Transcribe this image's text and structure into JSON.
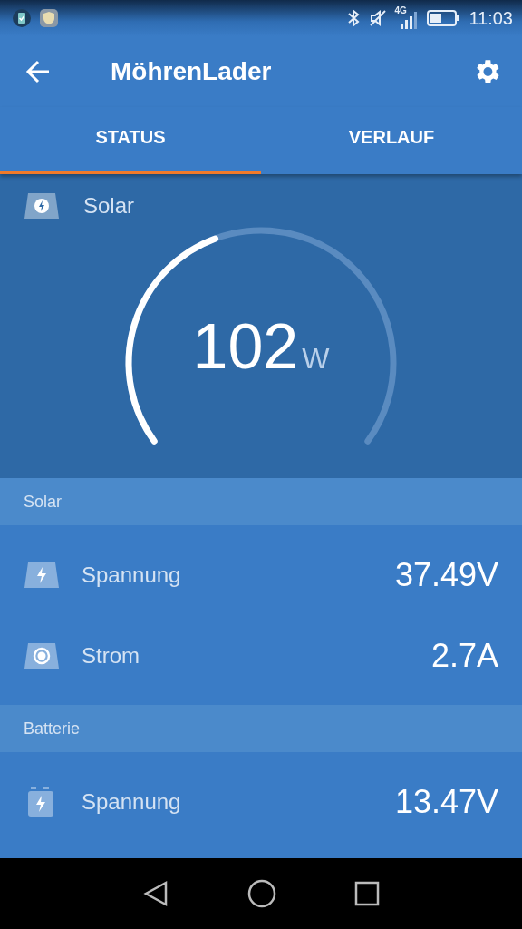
{
  "status_bar": {
    "network": "4G",
    "time": "11:03"
  },
  "app_bar": {
    "title": "MöhrenLader"
  },
  "tabs": [
    {
      "label": "STATUS",
      "selected": true
    },
    {
      "label": "VERLAUF",
      "selected": false
    }
  ],
  "gauge": {
    "label": "Solar",
    "value": "102",
    "unit": "W"
  },
  "sections": [
    {
      "title": "Solar",
      "rows": [
        {
          "kind": "voltage",
          "label": "Spannung",
          "value": "37.49V"
        },
        {
          "kind": "current",
          "label": "Strom",
          "value": "2.7A"
        }
      ]
    },
    {
      "title": "Batterie",
      "rows": [
        {
          "kind": "battery",
          "label": "Spannung",
          "value": "13.47V"
        }
      ]
    }
  ]
}
